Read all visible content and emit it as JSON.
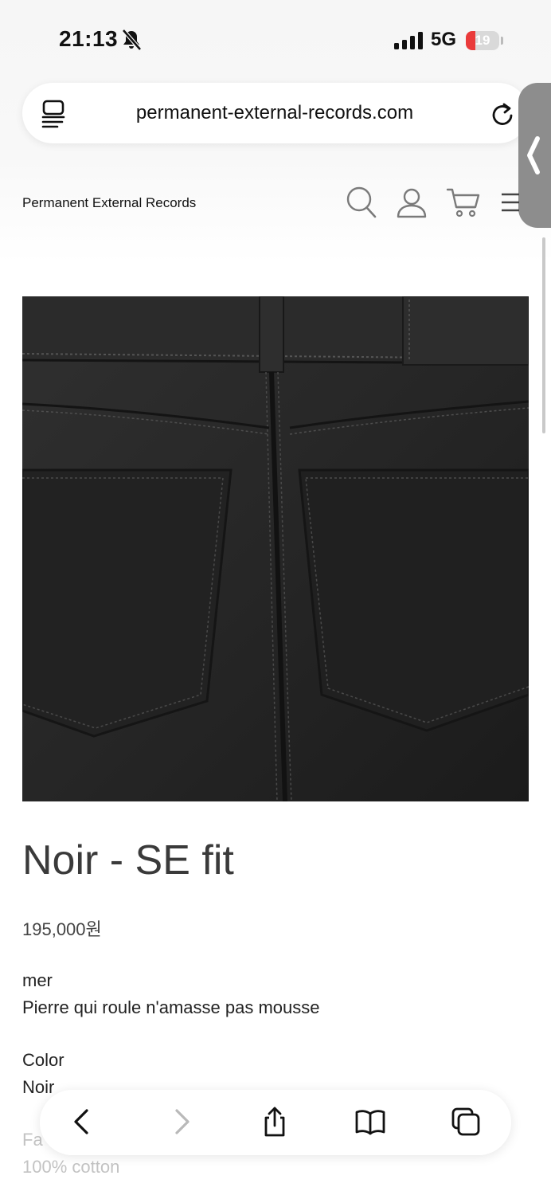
{
  "status_bar": {
    "time": "21:13",
    "network": "5G",
    "battery": "19",
    "battery_level_percent": 19
  },
  "browser": {
    "url": "permanent-external-records.com",
    "icons": [
      "reader-icon",
      "reload-icon",
      "side-chevron-icon"
    ]
  },
  "site_header": {
    "brand": "Permanent External Records",
    "icons": [
      "search-icon",
      "user-icon",
      "cart-icon",
      "menu-icon"
    ]
  },
  "product": {
    "image_alt": "Black denim jeans back pockets",
    "title": "Noir - SE fit",
    "price": "195,000원",
    "description_label": "mer",
    "description": "Pierre qui roule n'amasse pas mousse",
    "color_label": "Color",
    "color_value": "Noir",
    "fabric_label": "Fa",
    "fabric_value": "100% cotton"
  },
  "toolbar": {
    "items": [
      "back-icon",
      "forward-icon",
      "share-icon",
      "bookmarks-icon",
      "tabs-icon"
    ]
  },
  "colors": {
    "battery_low": "#ea3b3b",
    "title_text": "#3a3a3a",
    "denim": "#232323"
  }
}
